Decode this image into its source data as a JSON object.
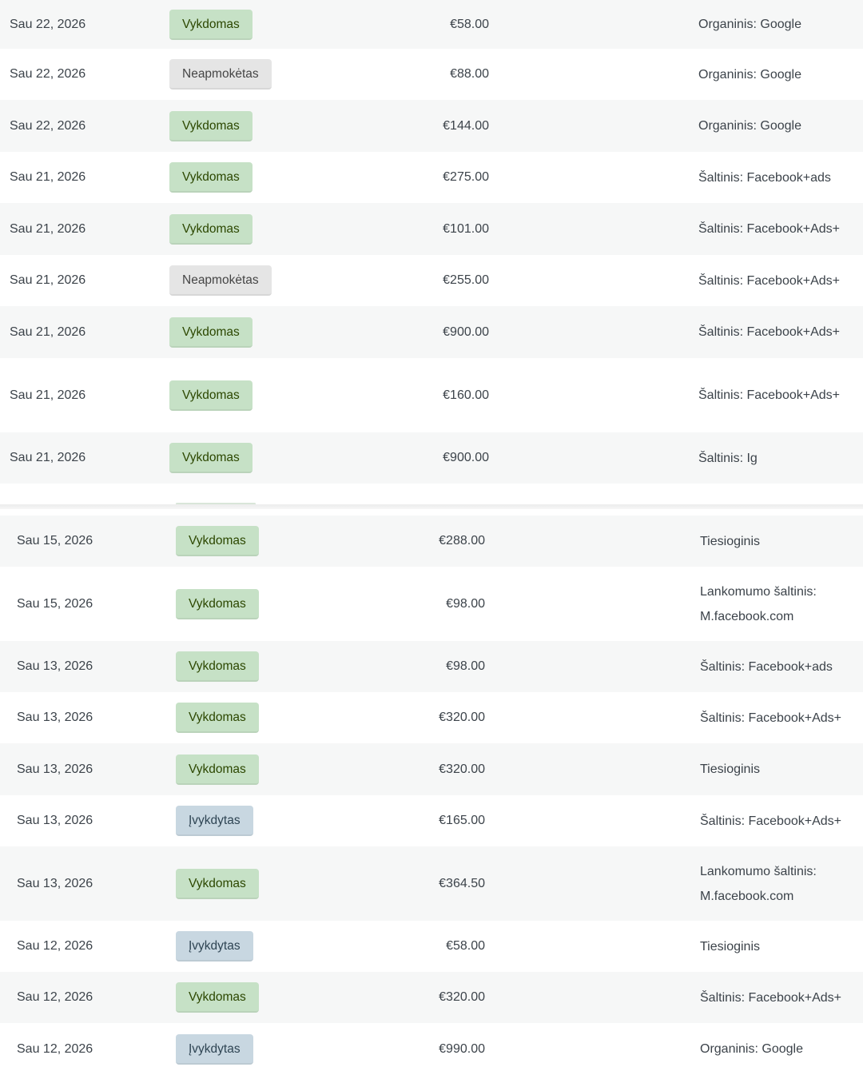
{
  "orders_top": [
    {
      "date": "Sau 22, 2026",
      "status": "Vykdomas",
      "status_type": "processing",
      "total": "€58.00",
      "origin": "Organinis: Google"
    },
    {
      "date": "Sau 22, 2026",
      "status": "Neapmokėtas",
      "status_type": "pending",
      "total": "€88.00",
      "origin": "Organinis: Google"
    },
    {
      "date": "Sau 22, 2026",
      "status": "Vykdomas",
      "status_type": "processing",
      "total": "€144.00",
      "origin": "Organinis: Google"
    },
    {
      "date": "Sau 21, 2026",
      "status": "Vykdomas",
      "status_type": "processing",
      "total": "€275.00",
      "origin": "Šaltinis: Facebook+ads"
    },
    {
      "date": "Sau 21, 2026",
      "status": "Vykdomas",
      "status_type": "processing",
      "total": "€101.00",
      "origin": "Šaltinis: Facebook+Ads+"
    },
    {
      "date": "Sau 21, 2026",
      "status": "Neapmokėtas",
      "status_type": "pending",
      "total": "€255.00",
      "origin": "Šaltinis: Facebook+Ads+"
    },
    {
      "date": "Sau 21, 2026",
      "status": "Vykdomas",
      "status_type": "processing",
      "total": "€900.00",
      "origin": "Šaltinis: Facebook+Ads+"
    },
    {
      "date": "Sau 21, 2026",
      "status": "Vykdomas",
      "status_type": "processing",
      "total": "€160.00",
      "origin": "Šaltinis: Facebook+Ads+"
    },
    {
      "date": "Sau 21, 2026",
      "status": "Vykdomas",
      "status_type": "processing",
      "total": "€900.00",
      "origin": "Šaltinis: Ig"
    }
  ],
  "orders_bottom": [
    {
      "date": "Sau 15, 2026",
      "status": "Vykdomas",
      "status_type": "processing",
      "total": "€288.00",
      "origin": "Tiesioginis"
    },
    {
      "date": "Sau 15, 2026",
      "status": "Vykdomas",
      "status_type": "processing",
      "total": "€98.00",
      "origin": "Lankomumo šaltinis:\nM.facebook.com"
    },
    {
      "date": "Sau 13, 2026",
      "status": "Vykdomas",
      "status_type": "processing",
      "total": "€98.00",
      "origin": "Šaltinis: Facebook+ads"
    },
    {
      "date": "Sau 13, 2026",
      "status": "Vykdomas",
      "status_type": "processing",
      "total": "€320.00",
      "origin": "Šaltinis: Facebook+Ads+"
    },
    {
      "date": "Sau 13, 2026",
      "status": "Vykdomas",
      "status_type": "processing",
      "total": "€320.00",
      "origin": "Tiesioginis"
    },
    {
      "date": "Sau 13, 2026",
      "status": "Įvykdytas",
      "status_type": "completed",
      "total": "€165.00",
      "origin": "Šaltinis: Facebook+Ads+"
    },
    {
      "date": "Sau 13, 2026",
      "status": "Vykdomas",
      "status_type": "processing",
      "total": "€364.50",
      "origin": "Lankomumo šaltinis:\nM.facebook.com"
    },
    {
      "date": "Sau 12, 2026",
      "status": "Įvykdytas",
      "status_type": "completed",
      "total": "€58.00",
      "origin": "Tiesioginis"
    },
    {
      "date": "Sau 12, 2026",
      "status": "Vykdomas",
      "status_type": "processing",
      "total": "€320.00",
      "origin": "Šaltinis: Facebook+Ads+"
    },
    {
      "date": "Sau 12, 2026",
      "status": "Įvykdytas",
      "status_type": "completed",
      "total": "€990.00",
      "origin": "Organinis: Google"
    }
  ],
  "colors": {
    "processing_bg": "#c6e1c6",
    "processing_text": "#2c4700",
    "pending_bg": "#e5e5e5",
    "pending_text": "#454545",
    "completed_bg": "#c8d7e1",
    "completed_text": "#2e4453",
    "row_alt_bg": "#f6f7f7"
  }
}
